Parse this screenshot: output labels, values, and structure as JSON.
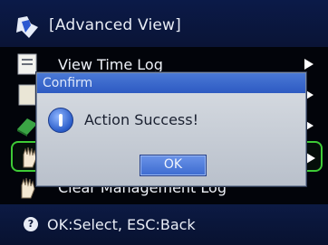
{
  "header": {
    "title": "[Advanced View]",
    "icon": "attendance-device-icon"
  },
  "menu": {
    "items": [
      {
        "label": "View Time Log",
        "icon": "log-book-icon",
        "has_arrow": true
      },
      {
        "label": "",
        "icon": "document-icon",
        "has_arrow": true
      },
      {
        "label": "",
        "icon": "eraser-icon",
        "has_arrow": true
      },
      {
        "label": "",
        "icon": "hand-icon",
        "has_arrow": true,
        "selected": true
      },
      {
        "label": "Clear Management Log",
        "icon": "hand-icon",
        "has_arrow": false
      }
    ]
  },
  "dialog": {
    "title": "Confirm",
    "message": "Action Success!",
    "ok_label": "OK",
    "icon": "info-icon"
  },
  "footer": {
    "hint": "OK:Select, ESC:Back",
    "icon": "info-dot-icon"
  },
  "colors": {
    "header_bg": "#0b1a48",
    "selected_border": "#3ecb36",
    "dialog_titlebar": "#2d5ac2"
  }
}
